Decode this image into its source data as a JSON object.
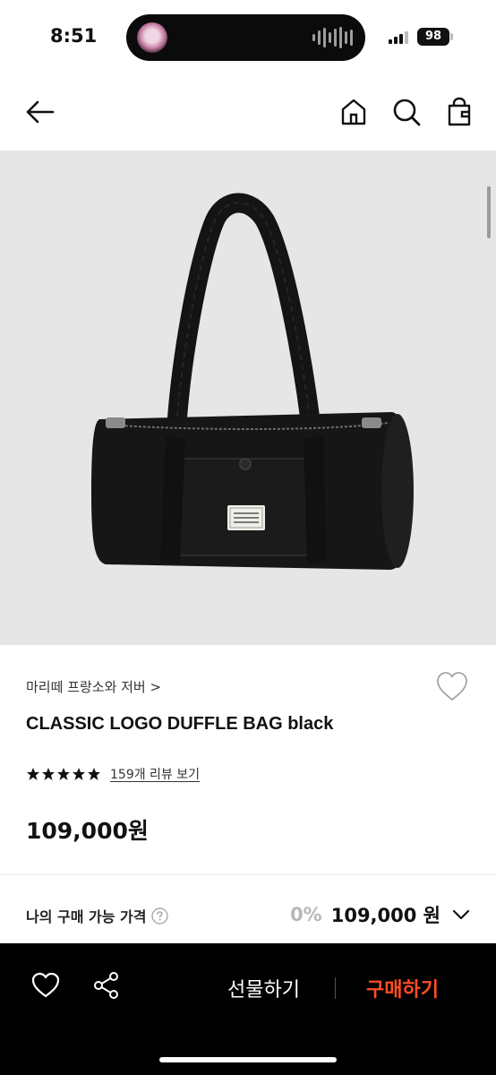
{
  "status_bar": {
    "time": "8:51",
    "battery": "98"
  },
  "nav": {
    "icons": [
      "back-arrow-icon",
      "home-icon",
      "search-icon",
      "shopping-bag-icon"
    ]
  },
  "product": {
    "label_text": "MARITHE FRANCOIS GIRBAUD",
    "brand": "마리떼 프랑소와 저버 >",
    "title": "CLASSIC LOGO DUFFLE BAG black",
    "rating_stars": 5,
    "review_link": "159개 리뷰 보기",
    "price": "109,000원"
  },
  "my_price": {
    "label": "나의 구매 가능 가격",
    "discount": "0%",
    "value": "109,000 원"
  },
  "bottom_bar": {
    "gift_label": "선물하기",
    "buy_label": "구매하기",
    "buy_color": "#ff4d24"
  }
}
